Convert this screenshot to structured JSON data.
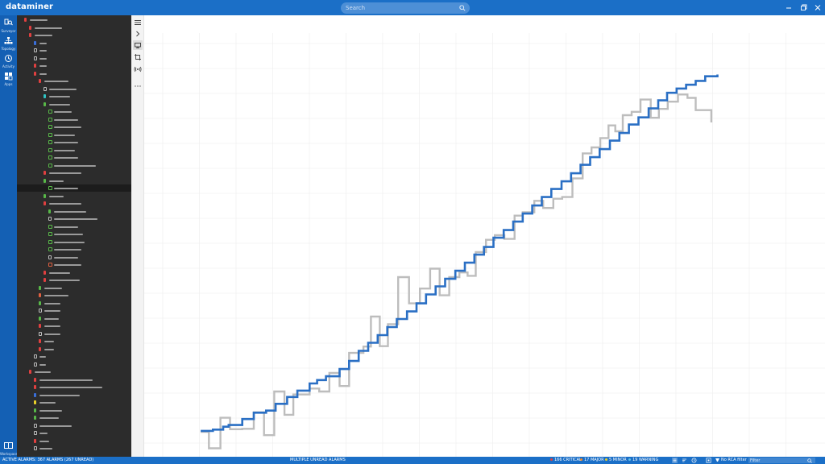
{
  "app": {
    "brand": "dataminer",
    "search_placeholder": "Search"
  },
  "nav": {
    "items": [
      {
        "label": "Surveyor",
        "icon": "surveyor-icon"
      },
      {
        "label": "Topology",
        "icon": "topology-icon"
      },
      {
        "label": "Activity",
        "icon": "activity-icon"
      },
      {
        "label": "Apps",
        "icon": "apps-icon"
      }
    ],
    "workspace_label": "Workspace"
  },
  "tree": {
    "rows": [
      {
        "indent": 0,
        "kind": "dot",
        "color": "#e04040",
        "bar": 22
      },
      {
        "indent": 1,
        "kind": "dot",
        "color": "#e04040",
        "bar": 34
      },
      {
        "indent": 1,
        "kind": "dot",
        "color": "#e04040",
        "bar": 22
      },
      {
        "indent": 2,
        "kind": "dot",
        "color": "#3a6fd8",
        "bar": 9
      },
      {
        "indent": 2,
        "kind": "box",
        "color": "#bdbdbd",
        "bar": 9
      },
      {
        "indent": 2,
        "kind": "box",
        "color": "#bdbdbd",
        "bar": 9
      },
      {
        "indent": 2,
        "kind": "dot",
        "color": "#e04040",
        "bar": 9
      },
      {
        "indent": 2,
        "kind": "dot",
        "color": "#e04040",
        "bar": 9
      },
      {
        "indent": 3,
        "kind": "dot",
        "color": "#e04040",
        "bar": 30
      },
      {
        "indent": 4,
        "kind": "box",
        "color": "#bdbdbd",
        "bar": 34
      },
      {
        "indent": 4,
        "kind": "dot",
        "color": "#2fc4c4",
        "bar": 26
      },
      {
        "indent": 4,
        "kind": "dot",
        "color": "#58b848",
        "bar": 26
      },
      {
        "indent": 5,
        "kind": "chk",
        "color": "#58b848",
        "bar": 22
      },
      {
        "indent": 5,
        "kind": "chk",
        "color": "#58b848",
        "bar": 30
      },
      {
        "indent": 5,
        "kind": "chk",
        "color": "#58b848",
        "bar": 34
      },
      {
        "indent": 5,
        "kind": "chk",
        "color": "#58b848",
        "bar": 26
      },
      {
        "indent": 5,
        "kind": "chk",
        "color": "#58b848",
        "bar": 30
      },
      {
        "indent": 5,
        "kind": "chk",
        "color": "#58b848",
        "bar": 26
      },
      {
        "indent": 5,
        "kind": "chk",
        "color": "#58b848",
        "bar": 30
      },
      {
        "indent": 5,
        "kind": "chk",
        "color": "#58b848",
        "bar": 52
      },
      {
        "indent": 4,
        "kind": "dot",
        "color": "#e04040",
        "bar": 40
      },
      {
        "indent": 4,
        "kind": "dot",
        "color": "#58b848",
        "bar": 18
      },
      {
        "indent": 5,
        "kind": "chk",
        "color": "#58b848",
        "bar": 30,
        "selected": true
      },
      {
        "indent": 4,
        "kind": "dot",
        "color": "#58b848",
        "bar": 18
      },
      {
        "indent": 4,
        "kind": "dot",
        "color": "#e04040",
        "bar": 40
      },
      {
        "indent": 5,
        "kind": "dot",
        "color": "#58b848",
        "bar": 40
      },
      {
        "indent": 5,
        "kind": "box",
        "color": "#bdbdbd",
        "bar": 54
      },
      {
        "indent": 5,
        "kind": "chk",
        "color": "#58b848",
        "bar": 30
      },
      {
        "indent": 5,
        "kind": "chk",
        "color": "#58b848",
        "bar": 36
      },
      {
        "indent": 5,
        "kind": "chk",
        "color": "#58b848",
        "bar": 38
      },
      {
        "indent": 5,
        "kind": "chk",
        "color": "#58b848",
        "bar": 34
      },
      {
        "indent": 5,
        "kind": "box",
        "color": "#bdbdbd",
        "bar": 30
      },
      {
        "indent": 5,
        "kind": "chk",
        "color": "#e06040",
        "bar": 34
      },
      {
        "indent": 4,
        "kind": "dot",
        "color": "#e04040",
        "bar": 26
      },
      {
        "indent": 4,
        "kind": "dot",
        "color": "#e04040",
        "bar": 38
      },
      {
        "indent": 3,
        "kind": "dot",
        "color": "#58b848",
        "bar": 22
      },
      {
        "indent": 3,
        "kind": "dot",
        "color": "#e06040",
        "bar": 30
      },
      {
        "indent": 3,
        "kind": "dot",
        "color": "#58b848",
        "bar": 20
      },
      {
        "indent": 3,
        "kind": "box",
        "color": "#bdbdbd",
        "bar": 20
      },
      {
        "indent": 3,
        "kind": "dot",
        "color": "#58b848",
        "bar": 18
      },
      {
        "indent": 3,
        "kind": "dot",
        "color": "#e04040",
        "bar": 20
      },
      {
        "indent": 3,
        "kind": "box",
        "color": "#bdbdbd",
        "bar": 20
      },
      {
        "indent": 3,
        "kind": "dot",
        "color": "#e04040",
        "bar": 12
      },
      {
        "indent": 3,
        "kind": "dot",
        "color": "#e04040",
        "bar": 12
      },
      {
        "indent": 2,
        "kind": "box",
        "color": "#bdbdbd",
        "bar": 8
      },
      {
        "indent": 2,
        "kind": "box",
        "color": "#bdbdbd",
        "bar": 8
      },
      {
        "indent": 1,
        "kind": "dot",
        "color": "#e04040",
        "bar": 20
      },
      {
        "indent": 2,
        "kind": "dot",
        "color": "#e04040",
        "bar": 66
      },
      {
        "indent": 2,
        "kind": "dot",
        "color": "#e04040",
        "bar": 78
      },
      {
        "indent": 2,
        "kind": "dot",
        "color": "#3a6fd8",
        "bar": 50
      },
      {
        "indent": 2,
        "kind": "dot",
        "color": "#e8d02a",
        "bar": 20
      },
      {
        "indent": 2,
        "kind": "dot",
        "color": "#58b848",
        "bar": 28
      },
      {
        "indent": 2,
        "kind": "dot",
        "color": "#58b848",
        "bar": 24
      },
      {
        "indent": 2,
        "kind": "box",
        "color": "#bdbdbd",
        "bar": 40
      },
      {
        "indent": 2,
        "kind": "box",
        "color": "#bdbdbd",
        "bar": 10
      },
      {
        "indent": 2,
        "kind": "dot",
        "color": "#e04040",
        "bar": 12
      },
      {
        "indent": 2,
        "kind": "box",
        "color": "#bdbdbd",
        "bar": 16
      }
    ]
  },
  "toolbar": {
    "tools": [
      {
        "icon": "hamburger-menu-icon"
      },
      {
        "icon": "chevron-right-icon"
      },
      {
        "icon": "monitor-icon",
        "active": true
      },
      {
        "icon": "crop-icon"
      },
      {
        "icon": "broadcast-icon"
      },
      {
        "icon": "more-options-icon"
      }
    ]
  },
  "chart_data": {
    "type": "line",
    "title": "",
    "xlabel": "",
    "ylabel": "",
    "xlim": [
      0,
      100
    ],
    "ylim": [
      0,
      100
    ],
    "grid": true,
    "series": [
      {
        "color": "#2a6fc4",
        "step": true,
        "x": [
          8.3,
          10.1,
          11.6,
          12.4,
          14.4,
          16.1,
          17.9,
          19.3,
          21.0,
          22.5,
          24.3,
          25.4,
          26.7,
          28.7,
          30.1,
          31.5,
          32.9,
          34.3,
          35.7,
          37.1,
          38.6,
          40.0,
          41.4,
          42.8,
          44.2,
          45.7,
          47.1,
          48.5,
          49.9,
          51.3,
          52.8,
          54.2,
          55.6,
          57.0,
          58.4,
          59.8,
          61.3,
          62.7,
          64.1,
          65.5,
          66.9,
          68.4,
          69.8,
          71.2,
          72.6,
          74.1,
          75.5,
          76.8,
          78.2,
          79.6,
          81.0,
          82.4,
          84.2
        ],
        "y": [
          6.1,
          6.4,
          7.1,
          7.5,
          8.9,
          10.4,
          10.9,
          12.5,
          14.1,
          15.6,
          17.3,
          18.1,
          19.0,
          20.7,
          22.6,
          25.0,
          26.9,
          28.7,
          30.6,
          32.5,
          34.3,
          36.2,
          38.3,
          40.2,
          42.0,
          43.9,
          45.8,
          47.7,
          49.5,
          51.7,
          53.5,
          55.5,
          57.4,
          59.3,
          61.3,
          63.2,
          65.0,
          66.9,
          68.9,
          70.7,
          72.6,
          74.6,
          76.4,
          78.4,
          80.1,
          82.2,
          84.1,
          85.9,
          86.9,
          87.8,
          88.7,
          89.8,
          90.2
        ]
      },
      {
        "color": "#bdbdbd",
        "step": true,
        "x": [
          8.3,
          9.5,
          11.2,
          12.6,
          14.4,
          16.1,
          17.6,
          19.1,
          20.6,
          21.9,
          24.3,
          25.7,
          27.2,
          28.7,
          30.1,
          32.2,
          33.3,
          34.6,
          35.8,
          37.3,
          38.9,
          40.5,
          42.0,
          43.4,
          44.8,
          46.3,
          47.5,
          48.7,
          50.2,
          51.5,
          52.9,
          54.4,
          55.6,
          57.3,
          58.6,
          60.1,
          61.4,
          62.9,
          64.4,
          65.7,
          67.0,
          68.2,
          69.2,
          70.3,
          71.6,
          72.9,
          74.4,
          75.6,
          76.9,
          78.4,
          79.8,
          81.0,
          83.3
        ],
        "y": [
          5.9,
          2.0,
          9.2,
          6.5,
          6.6,
          10.5,
          5.1,
          15.4,
          9.9,
          14.7,
          16.1,
          15.4,
          19.8,
          16.7,
          24.5,
          26.0,
          33.1,
          26.1,
          31.3,
          42.4,
          36.2,
          39.7,
          44.4,
          38.1,
          42.4,
          43.5,
          42.7,
          48.3,
          51.2,
          52.3,
          51.4,
          56.9,
          57.7,
          60.4,
          58.7,
          60.9,
          61.3,
          65.7,
          71.6,
          73.0,
          75.2,
          78.2,
          76.8,
          80.6,
          81.4,
          84.3,
          80.0,
          82.1,
          83.8,
          85.5,
          84.7,
          81.8,
          78.9
        ]
      }
    ]
  },
  "status": {
    "left_text": "ACTIVE ALARMS: 367 ALARMS (267 UNREAD)",
    "mid_text": "MULTIPLE UNREAD ALARMS",
    "severities": [
      {
        "label": "166 CRITICAL",
        "color": "#e04040"
      },
      {
        "label": "17 MAJOR",
        "color": "#f08a30"
      },
      {
        "label": "5 MINOR",
        "color": "#e8d02a"
      },
      {
        "label": "19 WARNING",
        "color": "#5fc1e8"
      }
    ],
    "rca_text": "No RCA filter",
    "filter_placeholder": "Filter"
  }
}
